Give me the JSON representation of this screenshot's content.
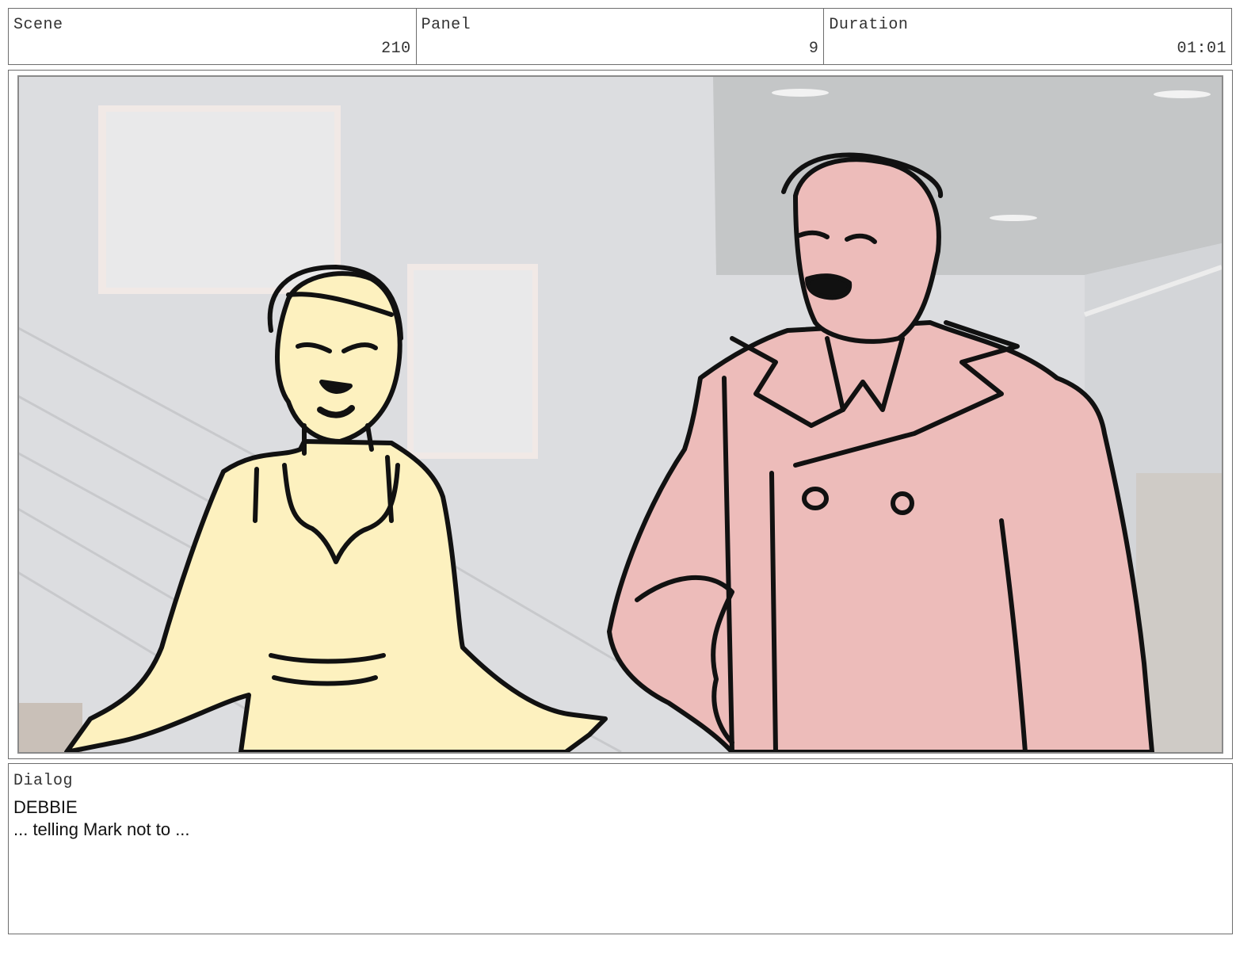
{
  "header": {
    "scene": {
      "label": "Scene",
      "value": "210"
    },
    "panel": {
      "label": "Panel",
      "value": "9"
    },
    "duration": {
      "label": "Duration",
      "value": "01:01"
    }
  },
  "artwork": {
    "characters": [
      "woman-in-yellow-dress",
      "man-in-pink-trench-coat"
    ],
    "colors": {
      "woman_fill": "#fdf1bf",
      "man_fill": "#edbcba",
      "wall": "#dcdde0",
      "ceiling": "#c3c5c6",
      "ink": "#111111"
    }
  },
  "dialog": {
    "label": "Dialog",
    "speaker": "DEBBIE",
    "line": "... telling Mark not to ..."
  }
}
